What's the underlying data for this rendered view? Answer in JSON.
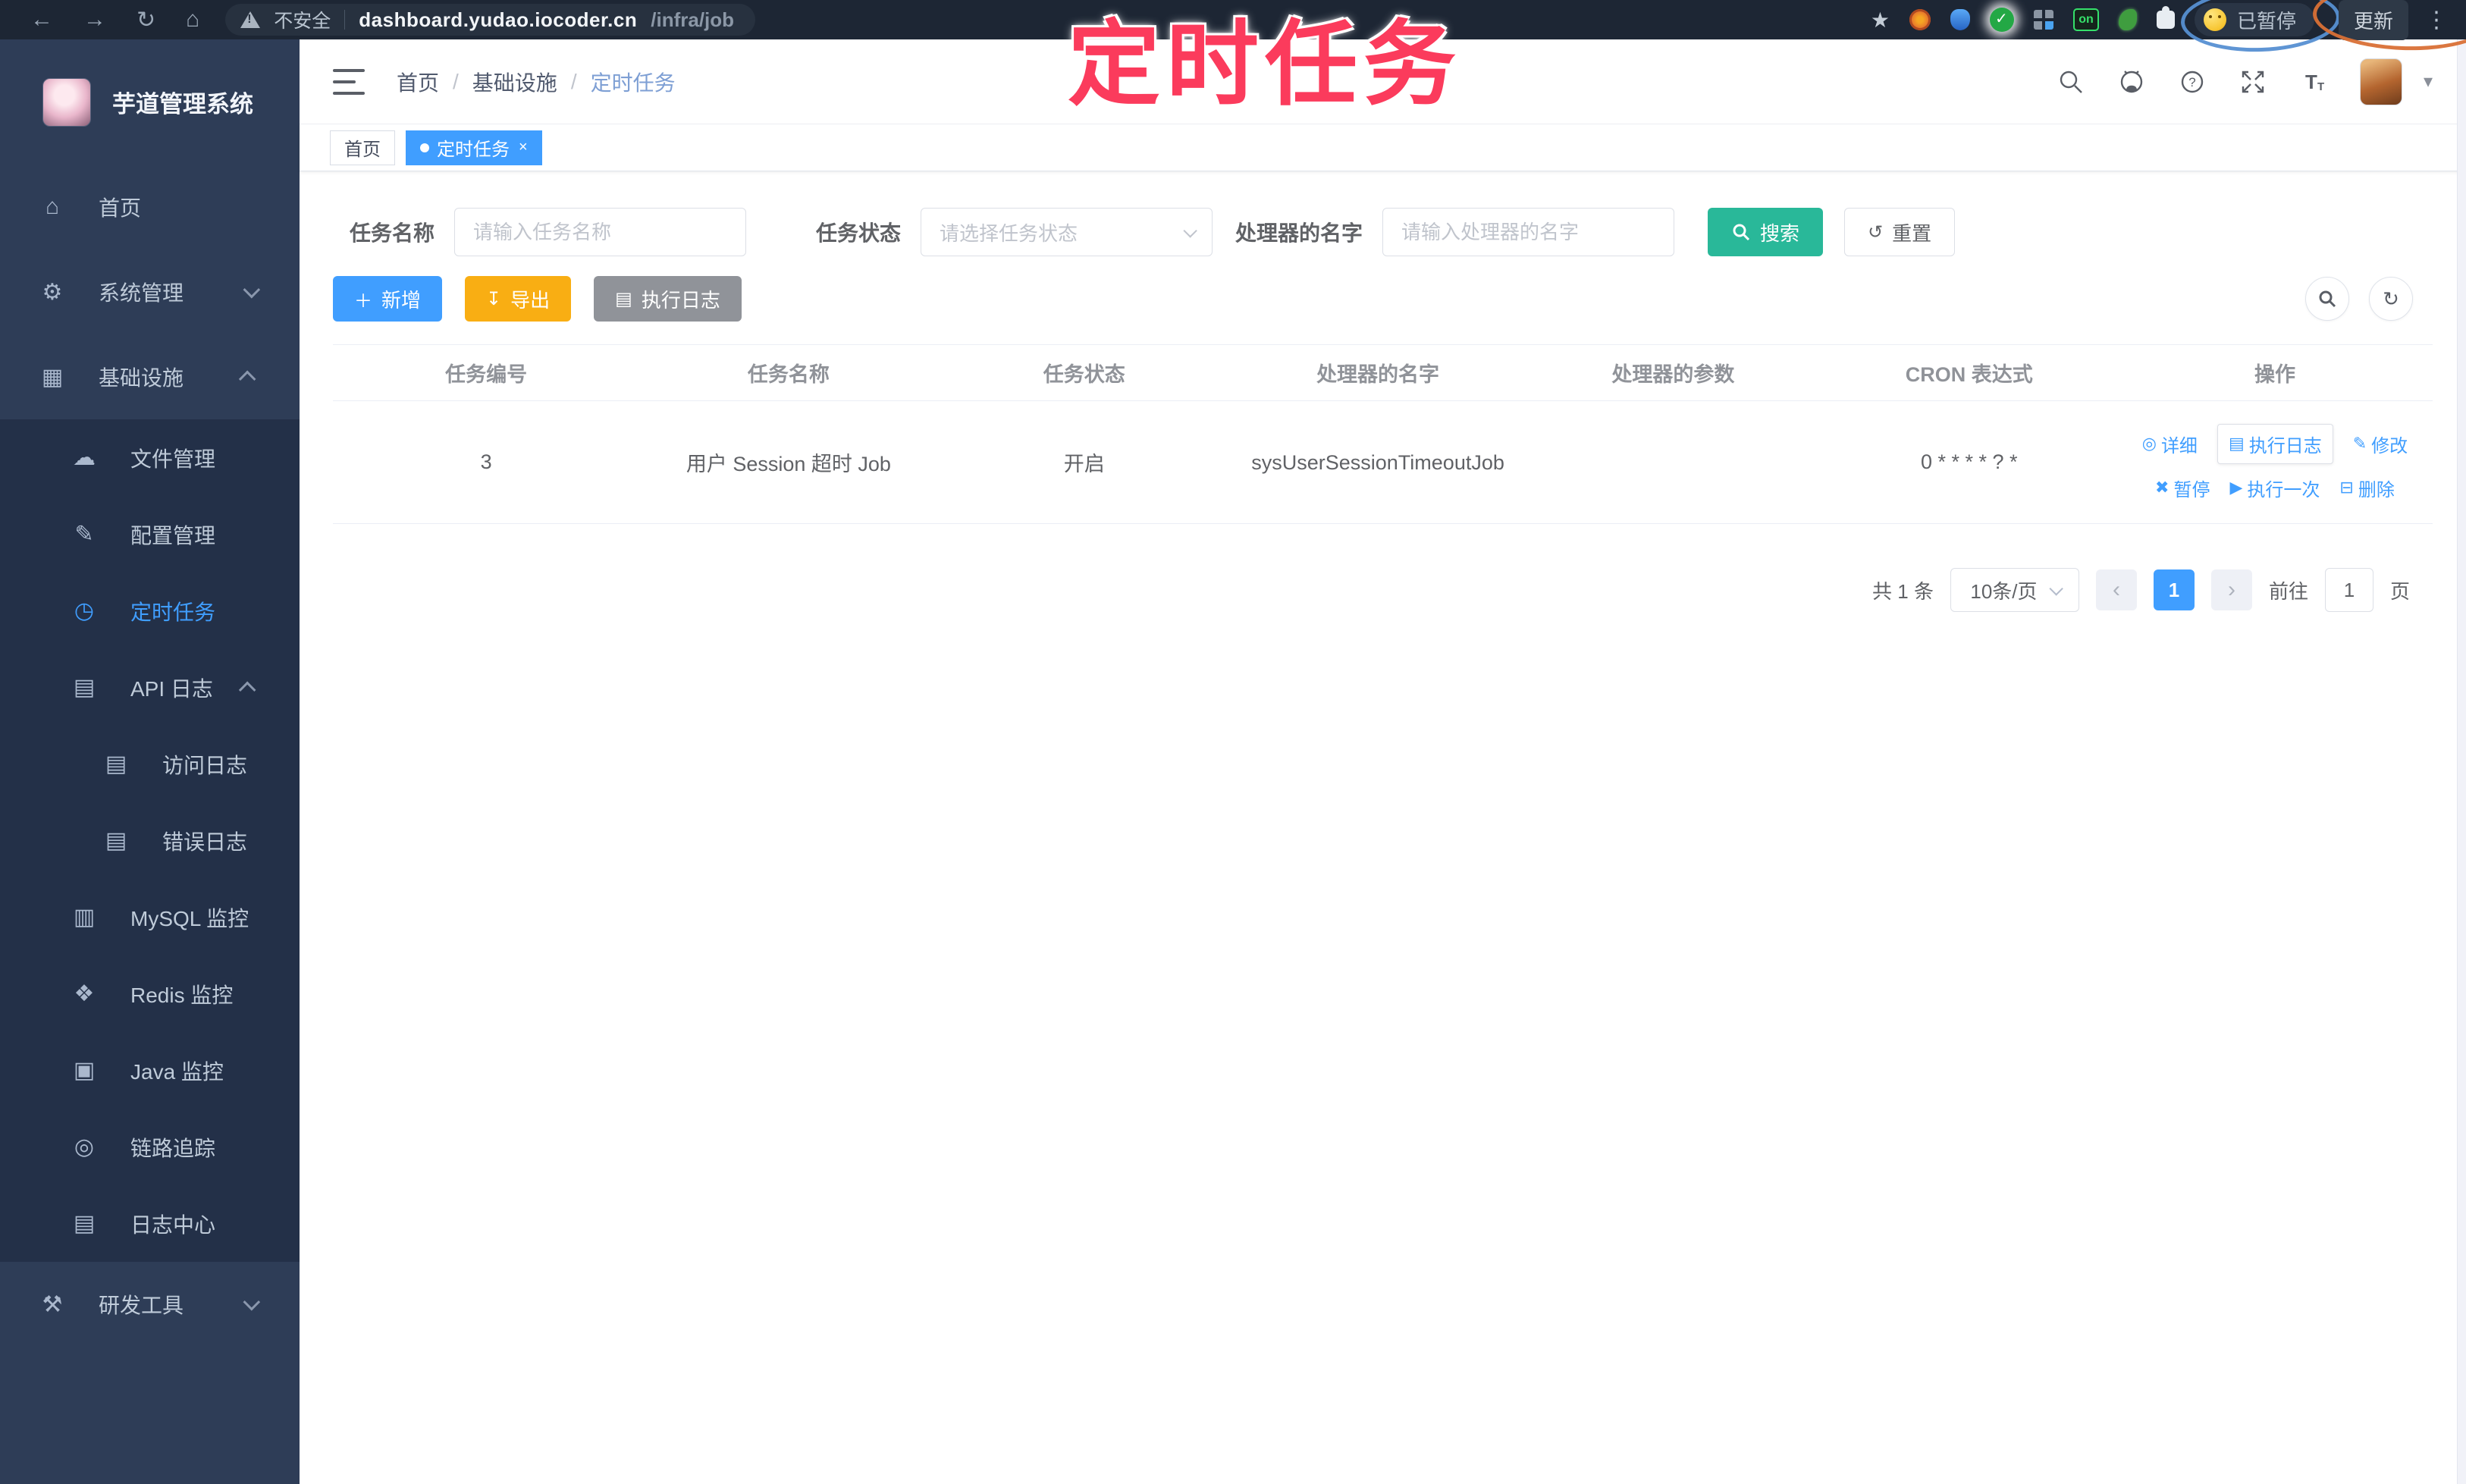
{
  "browser": {
    "nav_icons": {
      "back": "←",
      "forward": "→",
      "refresh": "↻",
      "home": "⌂"
    },
    "security_label": "不安全",
    "url_host": "dashboard.yudao.iocoder.cn",
    "url_path": "/infra/job",
    "star_icon": "★",
    "paused_label": "已暂停",
    "update_label": "更新",
    "kebab_icon": "⋮"
  },
  "overlay": {
    "title": "定时任务"
  },
  "sidebar": {
    "app_title": "芋道管理系统",
    "items": [
      {
        "label": "首页",
        "icon": "⌂"
      },
      {
        "label": "系统管理",
        "icon": "⚙"
      },
      {
        "label": "基础设施",
        "icon": "▦"
      },
      {
        "label": "文件管理",
        "icon": "☁"
      },
      {
        "label": "配置管理",
        "icon": "✎"
      },
      {
        "label": "定时任务",
        "icon": "◷"
      },
      {
        "label": "API 日志",
        "icon": "▤"
      },
      {
        "label": "访问日志",
        "icon": "▤"
      },
      {
        "label": "错误日志",
        "icon": "▤"
      },
      {
        "label": "MySQL 监控",
        "icon": "▥"
      },
      {
        "label": "Redis 监控",
        "icon": "❖"
      },
      {
        "label": "Java 监控",
        "icon": "▣"
      },
      {
        "label": "链路追踪",
        "icon": "◎"
      },
      {
        "label": "日志中心",
        "icon": "▤"
      },
      {
        "label": "研发工具",
        "icon": "⚒"
      }
    ]
  },
  "navbar": {
    "breadcrumb": [
      "首页",
      "基础设施",
      "定时任务"
    ],
    "separator": "/"
  },
  "tags": {
    "home_label": "首页",
    "active_label": "定时任务",
    "close_icon": "×"
  },
  "filters": {
    "name_label": "任务名称",
    "name_placeholder": "请输入任务名称",
    "status_label": "任务状态",
    "status_placeholder": "请选择任务状态",
    "handler_label": "处理器的名字",
    "handler_placeholder": "请输入处理器的名字",
    "search_label": "搜索",
    "reset_label": "重置",
    "reset_icon": "↺"
  },
  "toolbar": {
    "add_label": "新增",
    "add_icon": "＋",
    "export_label": "导出",
    "export_icon": "↧",
    "exec_log_label": "执行日志",
    "exec_log_icon": "▤",
    "refresh_icon": "↻"
  },
  "table": {
    "headers": [
      "任务编号",
      "任务名称",
      "任务状态",
      "处理器的名字",
      "处理器的参数",
      "CRON 表达式",
      "操作"
    ],
    "rows": [
      {
        "id": "3",
        "name": "用户 Session 超时 Job",
        "status": "开启",
        "handler": "sysUserSessionTimeoutJob",
        "param": "",
        "cron": "0 * * * * ? *"
      }
    ],
    "ops1": [
      {
        "icon": "◎",
        "label": "详细"
      },
      {
        "icon": "▤",
        "label": "执行日志"
      },
      {
        "icon": "✎",
        "label": "修改"
      }
    ],
    "ops2": [
      {
        "icon": "✖",
        "label": "暂停"
      },
      {
        "icon": "▶",
        "label": "执行一次"
      },
      {
        "icon": "⊟",
        "label": "删除"
      }
    ]
  },
  "pagination": {
    "total": "共 1 条",
    "page_size": "10条/页",
    "prev_icon": "‹",
    "current_page": "1",
    "next_icon": "›",
    "goto_label": "前往",
    "goto_value": "1",
    "page_unit": "页"
  },
  "colors": {
    "primary": "#409eff",
    "search_teal": "#29b899",
    "export_orange": "#f9ae13",
    "info_gray": "#909399",
    "overlay_pink": "#fb3b5c",
    "sidebar_bg": "#2e3d57",
    "submenu_bg": "#233048",
    "browser_bg": "#1d2634"
  }
}
